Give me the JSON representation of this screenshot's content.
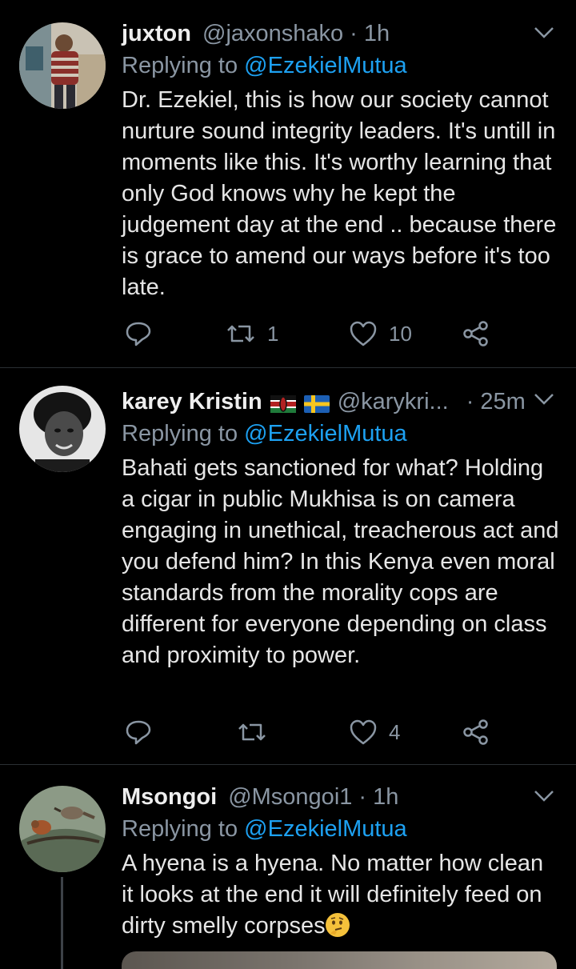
{
  "tweets": [
    {
      "name": "juxton",
      "handle": "@jaxonshako",
      "time": "· 1h",
      "replying_prefix": "Replying to",
      "replying_to": "@EzekielMutua",
      "text": "Dr. Ezekiel, this is how our society cannot nurture sound integrity leaders. It's untill in moments like this. It's worthy learning that only God knows why he kept the judgement day at the end .. because there is grace to amend our ways before it's too late.",
      "retweets": "1",
      "likes": "10"
    },
    {
      "name": "karey Kristin",
      "handle": "@karykri...",
      "time": "· 25m",
      "replying_prefix": "Replying to",
      "replying_to": "@EzekielMutua",
      "text": "Bahati gets sanctioned for what? Holding a cigar in public Mukhisa is on camera engaging in unethical, treacherous act and you defend him? In this Kenya even moral standards from the morality cops are different for everyone depending on class and proximity to power.",
      "retweets": "",
      "likes": "4"
    },
    {
      "name": "Msongoi",
      "handle": "@Msongoi1",
      "time": "· 1h",
      "replying_prefix": "Replying to",
      "replying_to": "@EzekielMutua",
      "text": "A hyena is a hyena. No matter how clean it looks at the end it will definitely feed on dirty smelly corpses",
      "emoji": "thinking-face-emoji"
    }
  ],
  "icons": {
    "reply": "reply-icon",
    "retweet": "retweet-icon",
    "like": "heart-icon",
    "share": "share-icon",
    "more": "chevron-down-icon"
  },
  "colors": {
    "background": "#000000",
    "link": "#1da1f2",
    "muted": "#8a96a3",
    "text": "#e6e6e6"
  }
}
